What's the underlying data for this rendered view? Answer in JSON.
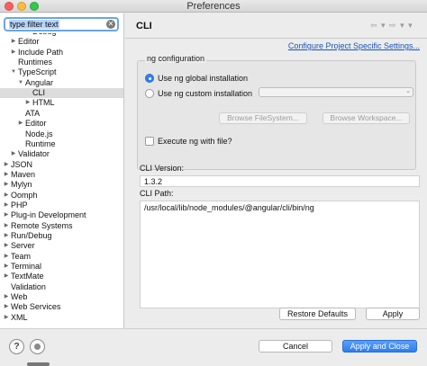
{
  "window": {
    "title": "Preferences"
  },
  "filter": {
    "value": "type filter text"
  },
  "tree": [
    {
      "label": "Debug",
      "arrow": ""
    },
    {
      "label": "Editor",
      "arrow": "▶"
    },
    {
      "label": "Include Path",
      "arrow": "▶"
    },
    {
      "label": "Runtimes",
      "arrow": ""
    },
    {
      "label": "TypeScript",
      "arrow": "▼"
    },
    {
      "label": "Angular",
      "arrow": "▼"
    },
    {
      "label": "CLI",
      "arrow": ""
    },
    {
      "label": "HTML",
      "arrow": "▶"
    },
    {
      "label": "ATA",
      "arrow": ""
    },
    {
      "label": "Editor",
      "arrow": "▶"
    },
    {
      "label": "Node.js",
      "arrow": ""
    },
    {
      "label": "Runtime",
      "arrow": ""
    },
    {
      "label": "Validator",
      "arrow": "▶"
    },
    {
      "label": "JSON",
      "arrow": "▶"
    },
    {
      "label": "Maven",
      "arrow": "▶"
    },
    {
      "label": "Mylyn",
      "arrow": "▶"
    },
    {
      "label": "Oomph",
      "arrow": "▶"
    },
    {
      "label": "PHP",
      "arrow": "▶"
    },
    {
      "label": "Plug-in Development",
      "arrow": "▶"
    },
    {
      "label": "Remote Systems",
      "arrow": "▶"
    },
    {
      "label": "Run/Debug",
      "arrow": "▶"
    },
    {
      "label": "Server",
      "arrow": "▶"
    },
    {
      "label": "Team",
      "arrow": "▶"
    },
    {
      "label": "Terminal",
      "arrow": "▶"
    },
    {
      "label": "TextMate",
      "arrow": "▶"
    },
    {
      "label": "Validation",
      "arrow": ""
    },
    {
      "label": "Web",
      "arrow": "▶"
    },
    {
      "label": "Web Services",
      "arrow": "▶"
    },
    {
      "label": "XML",
      "arrow": "▶"
    }
  ],
  "page": {
    "title": "CLI",
    "nav_arrows": "⇦ ▾ ⇨ ▾ ▾",
    "configure_link": "Configure Project Specific Settings...",
    "group_title": "ng configuration",
    "option_global": "Use ng global installation",
    "option_custom": "Use ng custom installation",
    "custom_path": "",
    "browse_filesystem": "Browse FileSystem...",
    "browse_workspace": "Browse Workspace...",
    "execute_label": "Execute ng with file?",
    "version_label": "CLI Version:",
    "version_value": "1.3.2",
    "path_label": "CLI Path:",
    "path_value": "/usr/local/lib/node_modules/@angular/cli/bin/ng",
    "restore_defaults": "Restore Defaults",
    "apply": "Apply"
  },
  "footer": {
    "help_glyph": "?",
    "cancel": "Cancel",
    "apply_and_close": "Apply and Close"
  },
  "colors": {
    "accent": "#2f7ff0",
    "link": "#1a55b8",
    "selection": "#dcdcdc"
  }
}
